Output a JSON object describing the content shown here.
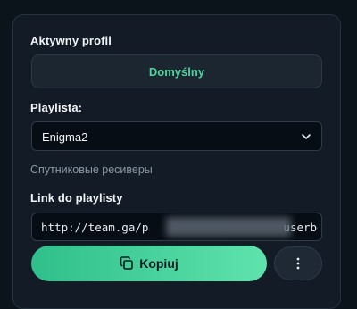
{
  "profile": {
    "label": "Aktywny profil",
    "value": "Domyślny"
  },
  "playlist": {
    "label": "Playlista:",
    "selected": "Enigma2",
    "description": "Спутниковые ресиверы"
  },
  "link": {
    "label": "Link do playlisty",
    "value_start": "http://team.ga/p",
    "value_end": "userbouque"
  },
  "actions": {
    "copy_label": "Kopiuj",
    "copy_icon": "copy-icon",
    "more_icon": "more-vertical-icon"
  },
  "colors": {
    "accent": "#4dd4a0",
    "panel": "#131c26",
    "background": "#0b131b"
  }
}
